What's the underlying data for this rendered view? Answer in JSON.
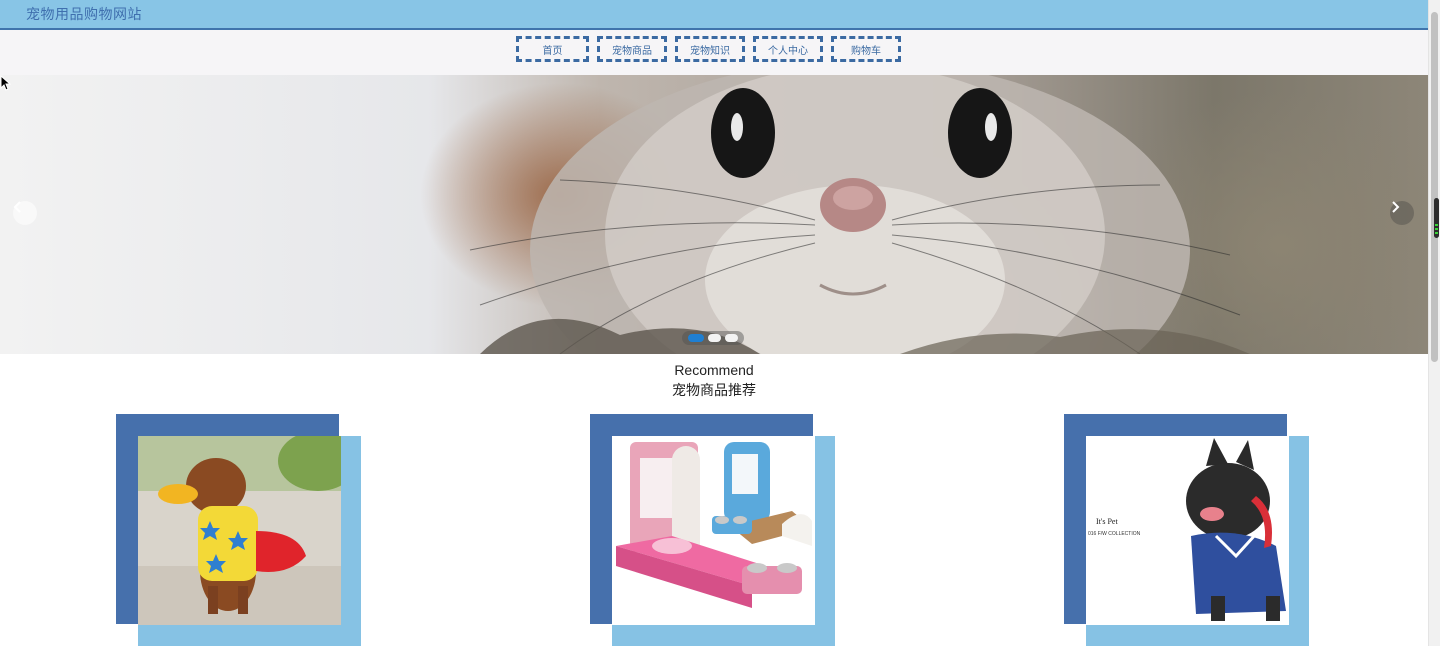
{
  "header": {
    "site_title": "宠物用品购物网站"
  },
  "nav": {
    "items": [
      {
        "label": "首页"
      },
      {
        "label": "宠物商品"
      },
      {
        "label": "宠物知识"
      },
      {
        "label": "个人中心"
      },
      {
        "label": "购物车"
      }
    ]
  },
  "carousel": {
    "slide_count": 3,
    "active_index": 0,
    "prev_icon": "chevron-left-icon",
    "next_icon": "chevron-right-icon"
  },
  "recommend": {
    "title_en": "Recommend",
    "title_cn": "宠物商品推荐",
    "products": [
      {
        "image": "poodle-in-star-sweater"
      },
      {
        "image": "pet-bed-wardrobe-set"
      },
      {
        "image": "french-bulldog-in-shirt",
        "image_text": "It's Pet 2016 F/W COLLECTION"
      }
    ]
  },
  "colors": {
    "topbar": "#88c5e6",
    "nav_border": "#3b6aa2",
    "card_dark": "#4670ac",
    "card_light": "#86c2e4",
    "dot_active": "#1f7fd2"
  }
}
